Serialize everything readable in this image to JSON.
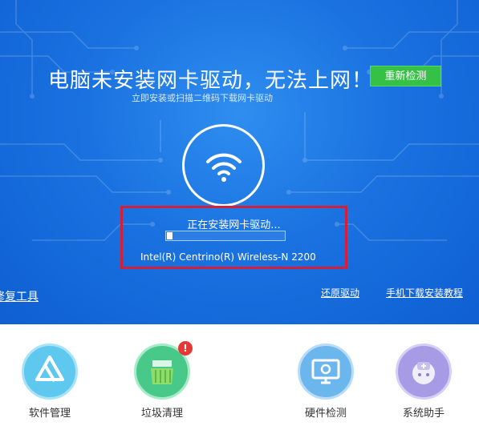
{
  "header": {
    "title": "电脑未安装网卡驱动，无法上网！",
    "subtitle": "立即安装或扫描二维码下载网卡驱动",
    "recheck_label": "重新检测"
  },
  "status": {
    "installing_text": "正在安装网卡驱动...",
    "progress": 0.05,
    "device_name": "Intel(R) Centrino(R) Wireless-N 2200"
  },
  "links": {
    "repair_tool": "修复工具",
    "restore_driver": "还原驱动",
    "mobile_tutorial": "手机下载安装教程"
  },
  "tools": [
    {
      "label": "软件管理",
      "icon": "drive-triangle-icon",
      "color": "#3fb6e6"
    },
    {
      "label": "垃圾清理",
      "icon": "broom-icon",
      "color": "#35c27b",
      "badge": "!"
    },
    {
      "label": "硬件检测",
      "icon": "monitor-gear-icon",
      "color": "#4aa3e8"
    },
    {
      "label": "系统助手",
      "icon": "assistant-robot-icon",
      "color": "#8b7fd6"
    }
  ],
  "colors": {
    "accent_green": "#35c046",
    "highlight_red": "#d3203a",
    "hero_blue": "#1a72e0"
  }
}
